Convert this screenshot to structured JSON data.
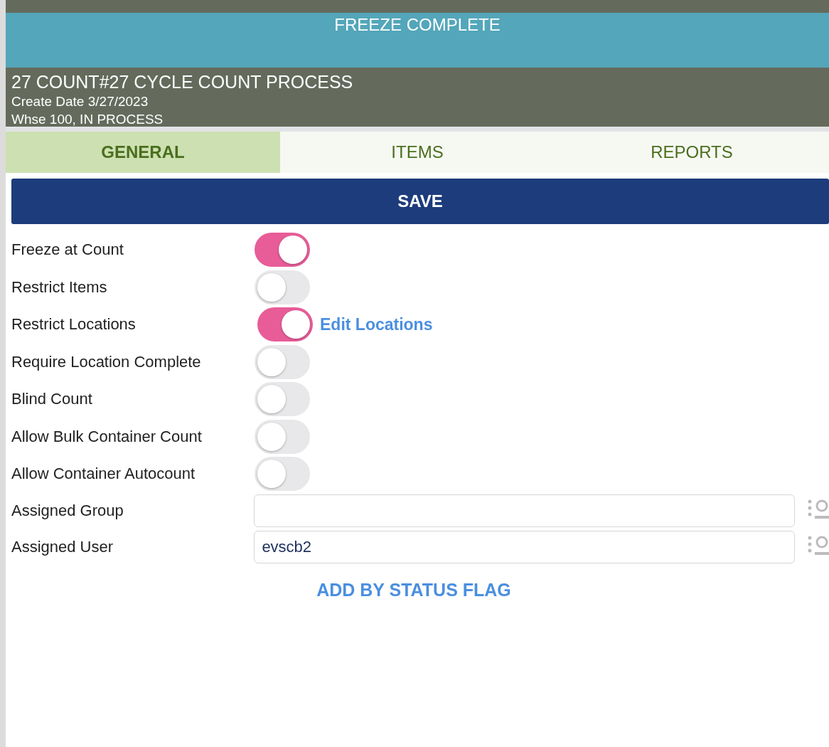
{
  "banner": {
    "title": "FREEZE COMPLETE"
  },
  "header": {
    "title": "27 COUNT#27 CYCLE COUNT PROCESS",
    "lines": [
      "Create Date 3/27/2023",
      "Whse 100, IN PROCESS"
    ]
  },
  "tabs": [
    {
      "label": "GENERAL",
      "selected": true
    },
    {
      "label": "ITEMS",
      "selected": false
    },
    {
      "label": "REPORTS",
      "selected": false
    }
  ],
  "save_button": "SAVE",
  "settings": [
    {
      "kind": "toggle",
      "label": "Freeze at Count",
      "on": true
    },
    {
      "kind": "toggle",
      "label": "Restrict Items",
      "on": false
    },
    {
      "kind": "toggle",
      "label": "Restrict Locations",
      "on": true,
      "link": "Edit Locations"
    },
    {
      "kind": "toggle",
      "label": "Require Location Complete",
      "on": false
    },
    {
      "kind": "toggle",
      "label": "Blind Count",
      "on": false
    },
    {
      "kind": "toggle",
      "label": "Allow Bulk Container Count",
      "on": false
    },
    {
      "kind": "toggle",
      "label": "Allow Container Autocount",
      "on": false
    },
    {
      "kind": "field",
      "label": "Assigned Group"
    },
    {
      "kind": "field",
      "label": "Assigned User",
      "value": "evscb2"
    }
  ],
  "action_link": "ADD BY STATUS FLAG"
}
